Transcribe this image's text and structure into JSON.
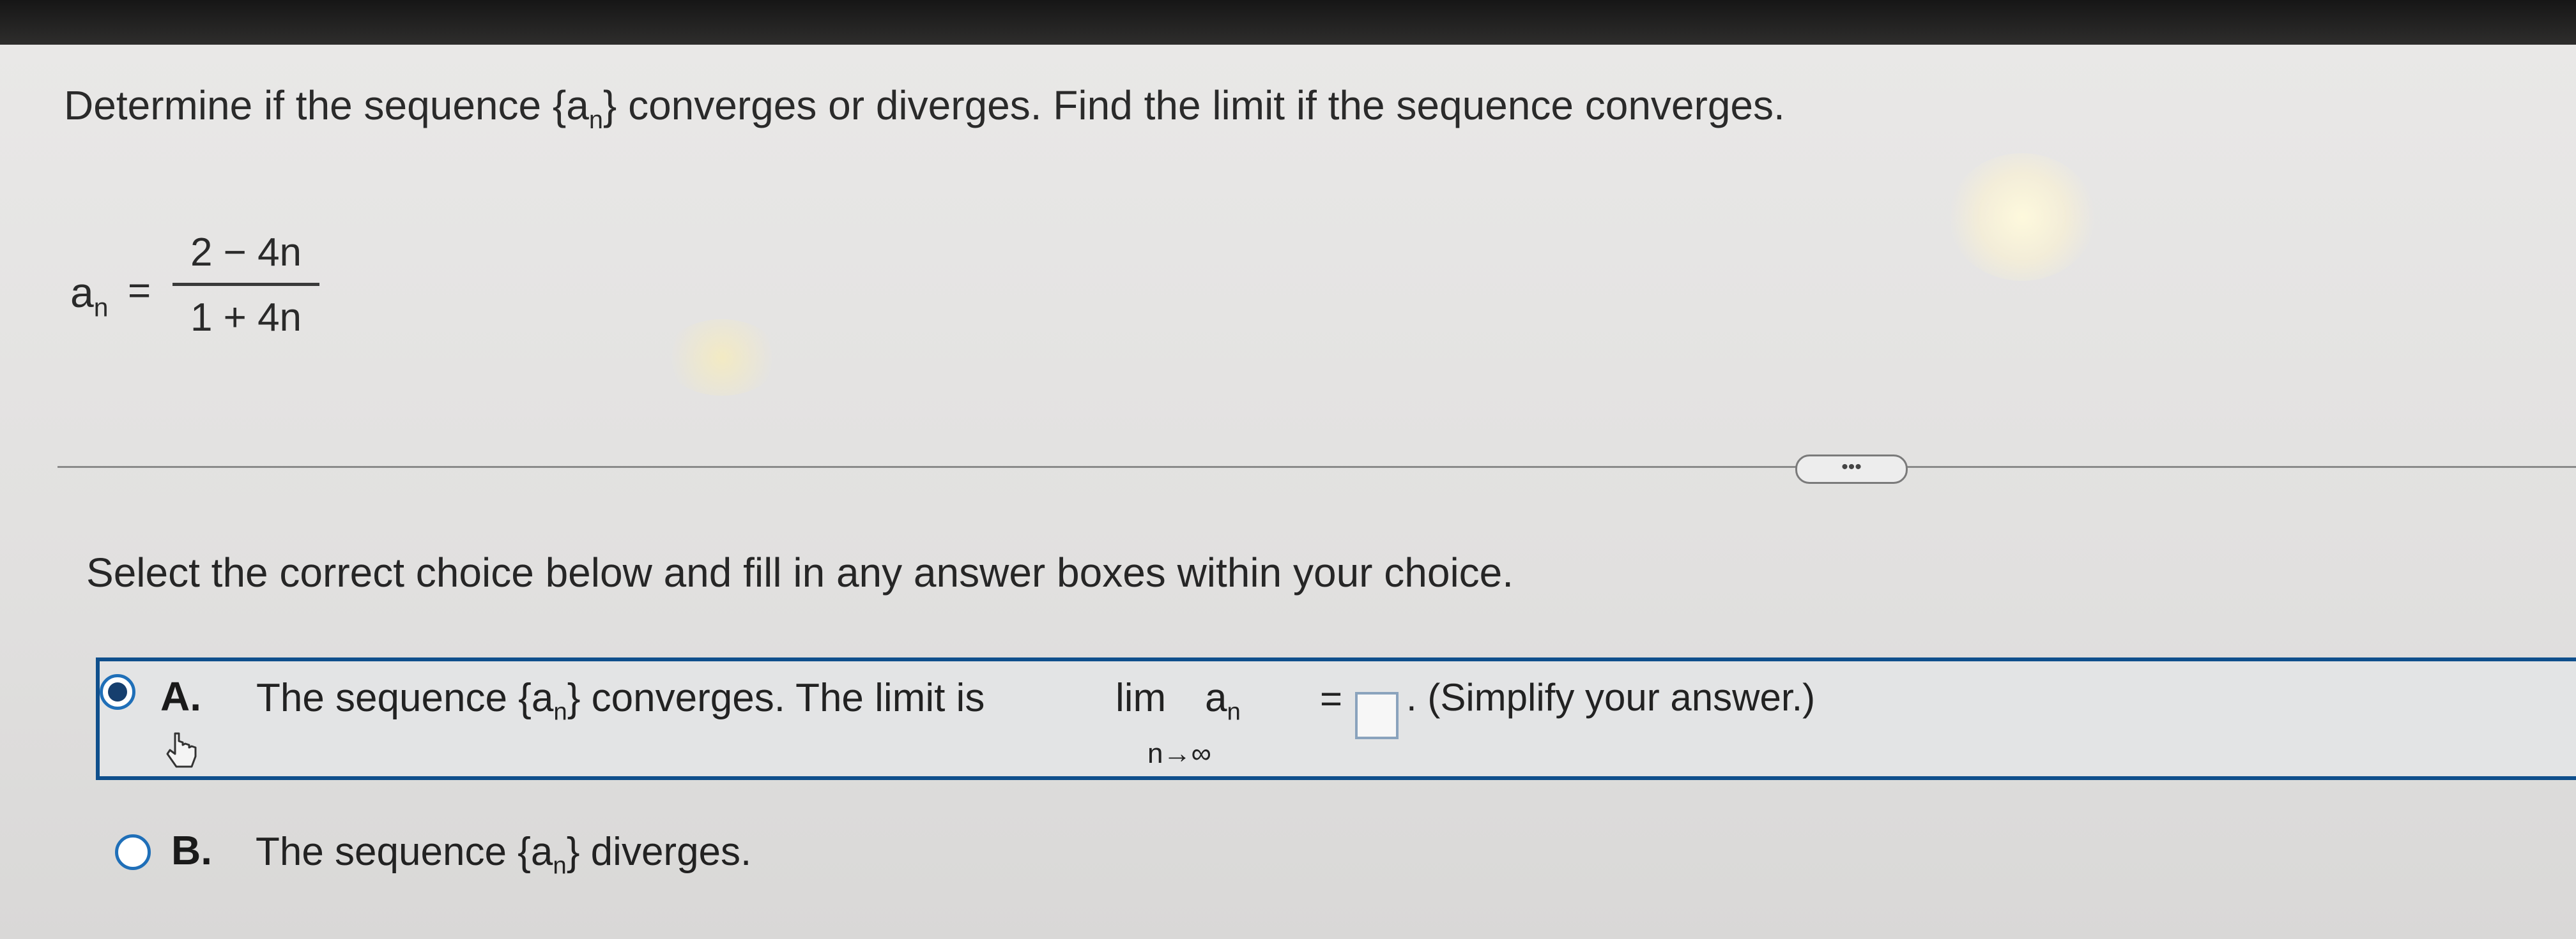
{
  "question": {
    "prefix": "Determine if the sequence {a",
    "sub": "n",
    "suffix": "} converges or diverges. Find the limit if the sequence converges."
  },
  "formula": {
    "lhs_base": "a",
    "lhs_sub": "n",
    "equals": "=",
    "numerator": "2 − 4n",
    "denominator": "1 + 4n"
  },
  "more_button": {
    "label": "•••"
  },
  "instruction": "Select the correct choice below and fill in any answer boxes within your choice.",
  "options": [
    {
      "letter": "A.",
      "selected": true,
      "text_prefix": "The sequence {a",
      "text_sub": "n",
      "text_suffix": "} converges. The limit is",
      "lim_word": "lim",
      "lim_under": "n→∞",
      "lim_an_base": "a",
      "lim_an_sub": "n",
      "equals": "=",
      "answer_value": "",
      "after_box": ". (Simplify your answer.)"
    },
    {
      "letter": "B.",
      "selected": false,
      "text_prefix": "The sequence {a",
      "text_sub": "n",
      "text_suffix": "} diverges."
    }
  ],
  "colors": {
    "selection_border": "#0f4f8c",
    "radio": "#1f6fb8"
  }
}
